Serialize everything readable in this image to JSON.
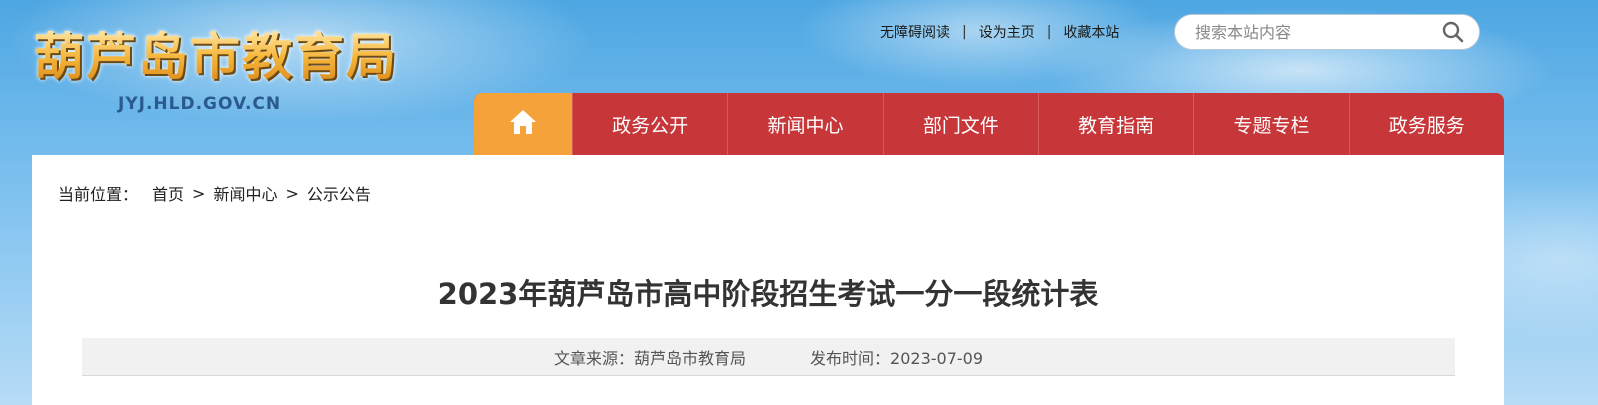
{
  "header": {
    "logo_title": "葫芦岛市教育局",
    "logo_domain": "JYJ.HLD.GOV.CN",
    "toplinks": [
      "无障碍阅读",
      "设为主页",
      "收藏本站"
    ],
    "search": {
      "placeholder": "搜索本站内容",
      "icon": "search-icon"
    }
  },
  "nav": {
    "home_icon": "home-icon",
    "items": [
      "政务公开",
      "新闻中心",
      "部门文件",
      "教育指南",
      "专题专栏",
      "政务服务"
    ]
  },
  "breadcrumb": {
    "label": "当前位置：",
    "items": [
      "首页",
      "新闻中心",
      "公示公告"
    ],
    "separator": ">"
  },
  "article": {
    "title": "2023年葫芦岛市高中阶段招生考试一分一段统计表",
    "source_label": "文章来源：",
    "source": "葫芦岛市教育局",
    "date_label": "发布时间：",
    "date": "2023-07-09"
  },
  "colors": {
    "nav_red": "#c7373a",
    "home_orange": "#f5a23a",
    "logo_gold": "#f4b23a",
    "sky_blue": "#4da6e2"
  }
}
